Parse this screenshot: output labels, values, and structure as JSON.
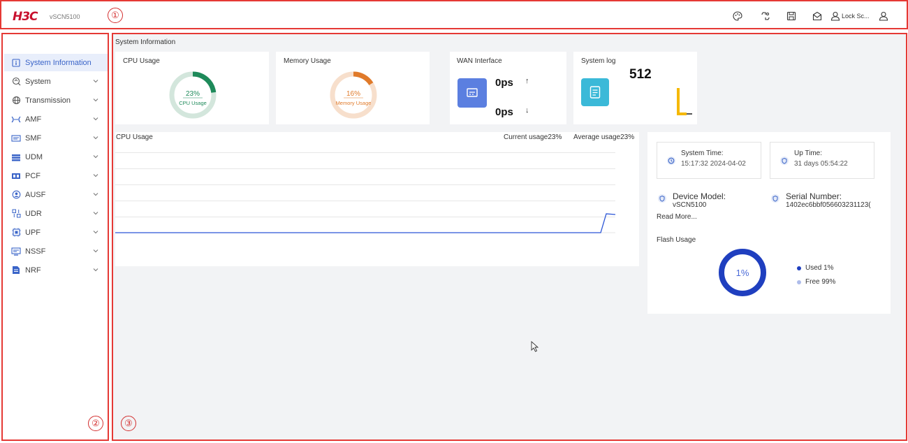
{
  "header": {
    "logo": "H3C",
    "product": "vSCN5100",
    "lock_label": "Lock Sc...",
    "icons": [
      "palette-icon",
      "bug-icon",
      "save-icon",
      "mail-icon",
      "lock-user-icon",
      "user-icon"
    ],
    "region_marker": "①"
  },
  "sidebar": {
    "region_marker": "②",
    "items": [
      {
        "label": "System Information",
        "icon": "info-icon",
        "active": true
      },
      {
        "label": "System",
        "icon": "system-icon"
      },
      {
        "label": "Transmission",
        "icon": "transmission-icon"
      },
      {
        "label": "AMF",
        "icon": "amf-icon"
      },
      {
        "label": "SMF",
        "icon": "smf-icon"
      },
      {
        "label": "UDM",
        "icon": "udm-icon"
      },
      {
        "label": "PCF",
        "icon": "pcf-icon"
      },
      {
        "label": "AUSF",
        "icon": "ausf-icon"
      },
      {
        "label": "UDR",
        "icon": "udr-icon"
      },
      {
        "label": "UPF",
        "icon": "upf-icon"
      },
      {
        "label": "NSSF",
        "icon": "nssf-icon"
      },
      {
        "label": "NRF",
        "icon": "nrf-icon"
      }
    ]
  },
  "main": {
    "region_marker": "③",
    "page_title": "System Information",
    "cpu_card": {
      "title": "CPU Usage",
      "value": "23%",
      "label": "CPU Usage",
      "percent": 23,
      "color": "#1e8a5a",
      "track": "#d3e6dc"
    },
    "memory_card": {
      "title": "Memory Usage",
      "value": "16%",
      "label": "Memory Usage",
      "percent": 16,
      "color": "#e07a2a",
      "track": "#f7dfcc"
    },
    "wan_card": {
      "title": "WAN Interface",
      "up": "0ps",
      "down": "0ps",
      "up_arrow": "↑",
      "down_arrow": "↓",
      "color": "#5b7fe0"
    },
    "syslog_card": {
      "title": "System log",
      "count": "512",
      "color": "#3bb9d8"
    },
    "cpu_chart": {
      "title": "CPU Usage",
      "current": "Current usage23%",
      "average": "Average usage23%"
    },
    "system_time": {
      "label": "System Time:",
      "value": "15:17:32  2024-04-02"
    },
    "up_time": {
      "label": "Up Time:",
      "value": "31 days  05:54:22"
    },
    "device_model": {
      "label": "Device Model:",
      "value": "vSCN5100"
    },
    "serial_number": {
      "label": "Serial Number:",
      "value": "1402ec6bbf056603231123("
    },
    "read_more": "Read More...",
    "flash": {
      "title": "Flash Usage",
      "value": "1%",
      "used_label": "Used 1%",
      "free_label": "Free 99%",
      "used_percent": 1,
      "used_color": "#1f3fbf",
      "free_color": "#aebcea"
    }
  }
}
